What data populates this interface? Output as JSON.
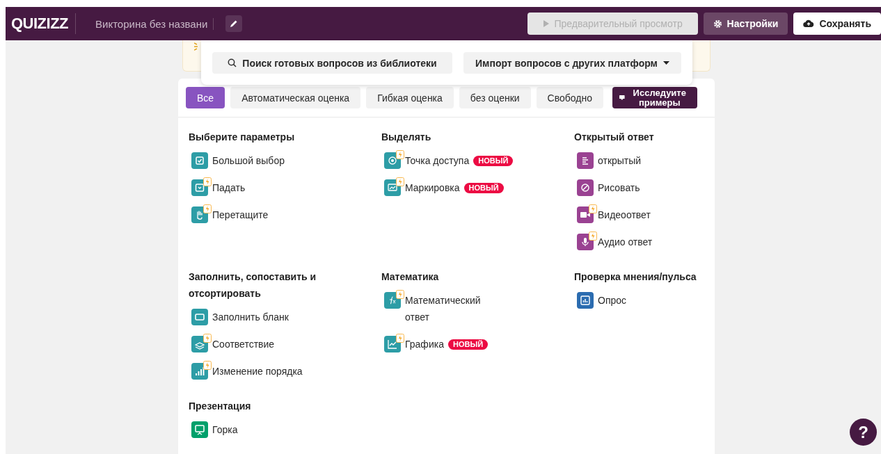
{
  "header": {
    "logo": "QUIZIZZ",
    "quiz_title": "Викторина без названи",
    "buttons": [
      {
        "kind": "preview",
        "label": "Предварительный просмотр",
        "disabled": true
      },
      {
        "kind": "settings",
        "label": "Настройки"
      },
      {
        "kind": "save",
        "label": "Сохранять"
      }
    ]
  },
  "popup": {
    "search": "Поиск готовых вопросов из библиотеки",
    "import": "Импорт вопросов с других платформ"
  },
  "filters": [
    {
      "label": "Все",
      "selected": true
    },
    {
      "label": "Автоматическая оценка",
      "selected": false
    },
    {
      "label": "Гибкая оценка",
      "selected": false
    },
    {
      "label": "без оценки",
      "selected": false
    },
    {
      "label": "Свободно",
      "selected": false
    }
  ],
  "explore_button": "Исследуите примеры",
  "sections": [
    {
      "title": "Выберите параметры",
      "items": [
        {
          "kind": "choice",
          "label": "Большой выбор",
          "color": "#2d9da6",
          "premium": false
        },
        {
          "kind": "dropdown",
          "label": "Падать",
          "color": "#2d9da6",
          "premium": true
        },
        {
          "kind": "drag",
          "label": "Перетащите",
          "color": "#2d9da6",
          "premium": true
        }
      ]
    },
    {
      "title": "Выделять",
      "items": [
        {
          "kind": "hotspot",
          "label": "Точка доступа",
          "color": "#2d9da6",
          "premium": true,
          "badge": "НОВЫЙ"
        },
        {
          "kind": "labeling",
          "label": "Маркировка",
          "color": "#2d9da6",
          "premium": true,
          "badge": "НОВЫЙ"
        }
      ]
    },
    {
      "title": "Открытый ответ",
      "items": [
        {
          "kind": "open",
          "label": "открытый",
          "color": "#9a4292",
          "premium": false
        },
        {
          "kind": "draw",
          "label": "Рисовать",
          "color": "#9a4292",
          "premium": false
        },
        {
          "kind": "video",
          "label": "Видеоответ",
          "color": "#9a4292",
          "premium": true
        },
        {
          "kind": "audio",
          "label": "Аудио ответ",
          "color": "#9a4292",
          "premium": true
        }
      ]
    },
    {
      "title": "Заполнить, сопоставить и отсортировать",
      "items": [
        {
          "kind": "blank",
          "label": "Заполнить бланк",
          "color": "#2d9da6",
          "premium": false
        },
        {
          "kind": "match",
          "label": "Соответствие",
          "color": "#2d9da6",
          "premium": true
        },
        {
          "kind": "reorder",
          "label": "Изменение порядка",
          "color": "#2d9da6",
          "premium": true
        }
      ]
    },
    {
      "title": "Математика",
      "items": [
        {
          "kind": "math",
          "label": "Математический ответ",
          "color": "#2d9da6",
          "premium": true
        },
        {
          "kind": "graph",
          "label": "Графика",
          "color": "#2d9da6",
          "premium": true,
          "badge": "НОВЫЙ"
        }
      ]
    },
    {
      "title": "Проверка мнения/пульса",
      "items": [
        {
          "kind": "poll",
          "label": "Опрос",
          "color": "#2b6cb0",
          "premium": false
        }
      ]
    },
    {
      "title": "Презентация",
      "items": [
        {
          "kind": "slide",
          "label": "Горка",
          "color": "#00a06b",
          "premium": false
        }
      ]
    }
  ],
  "help_button": "?"
}
